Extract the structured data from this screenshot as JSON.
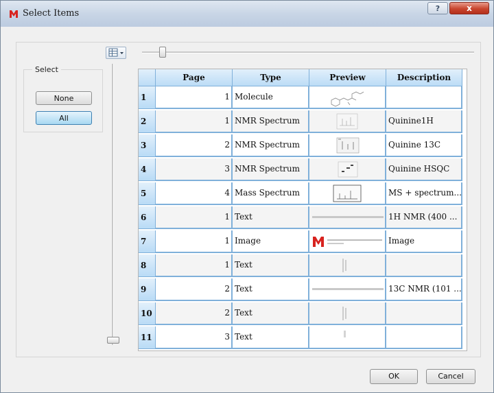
{
  "window": {
    "title": "Select Items",
    "help_glyph": "?",
    "close_glyph": "x"
  },
  "select_panel": {
    "label": "Select",
    "none_label": "None",
    "all_label": "All"
  },
  "table": {
    "columns": [
      "Page",
      "Type",
      "Preview",
      "Description"
    ],
    "rows": [
      {
        "n": "1",
        "page": "1",
        "type": "Molecule",
        "preview": "molecule",
        "description": ""
      },
      {
        "n": "2",
        "page": "1",
        "type": "NMR Spectrum",
        "preview": "nmr1h",
        "description": "Quinine1H"
      },
      {
        "n": "3",
        "page": "2",
        "type": "NMR Spectrum",
        "preview": "nmr13c",
        "description": "Quinine 13C"
      },
      {
        "n": "4",
        "page": "3",
        "type": "NMR Spectrum",
        "preview": "hsqc",
        "description": "Quinine HSQC"
      },
      {
        "n": "5",
        "page": "4",
        "type": "Mass Spectrum",
        "preview": "mass",
        "description": "MS + spectrum..."
      },
      {
        "n": "6",
        "page": "1",
        "type": "Text",
        "preview": "textline",
        "description": "1H NMR (400 ..."
      },
      {
        "n": "7",
        "page": "1",
        "type": "Image",
        "preview": "logo",
        "description": "Image"
      },
      {
        "n": "8",
        "page": "1",
        "type": "Text",
        "preview": "textnarrow",
        "description": ""
      },
      {
        "n": "9",
        "page": "2",
        "type": "Text",
        "preview": "textline",
        "description": "13C NMR (101 ..."
      },
      {
        "n": "10",
        "page": "2",
        "type": "Text",
        "preview": "textnarrow",
        "description": ""
      },
      {
        "n": "11",
        "page": "3",
        "type": "Text",
        "preview": "textsmall",
        "description": ""
      }
    ]
  },
  "footer": {
    "ok_label": "OK",
    "cancel_label": "Cancel"
  },
  "colors": {
    "grid_line": "#7fb0da",
    "header_top": "#e2f0fb",
    "close_red": "#c8452e",
    "logo_red": "#d8231f"
  }
}
